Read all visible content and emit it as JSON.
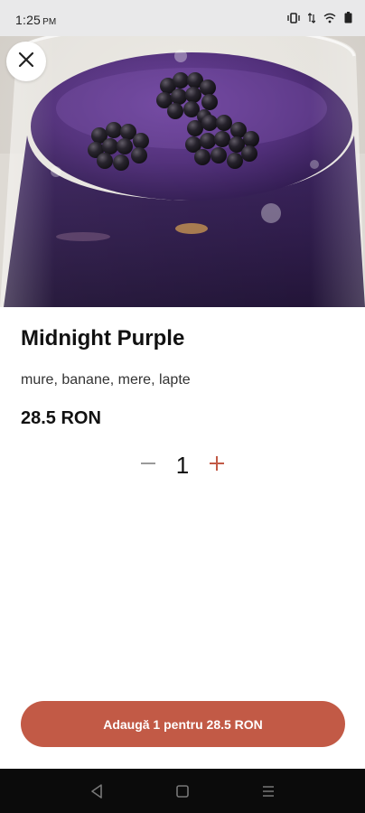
{
  "status_bar": {
    "time": "1:25",
    "ampm": "PM",
    "icons": [
      "vibrate-icon",
      "data-arrows-icon",
      "wifi-icon",
      "battery-icon"
    ]
  },
  "product": {
    "name": "Midnight Purple",
    "ingredients": "mure, banane, mere, lapte",
    "price": "28.5 RON",
    "image_icon": "smoothie-photo"
  },
  "quantity": {
    "value": "1",
    "minus_icon": "minus-icon",
    "plus_icon": "plus-icon"
  },
  "actions": {
    "close_icon": "close-icon",
    "add_label": "Adaugă 1 pentru 28.5 RON"
  },
  "nav": [
    "back-icon",
    "home-icon",
    "recents-icon"
  ],
  "colors": {
    "accent": "#c25a46",
    "status_bar": "#e9e9ea",
    "nav_bar": "#0b0b0b"
  }
}
